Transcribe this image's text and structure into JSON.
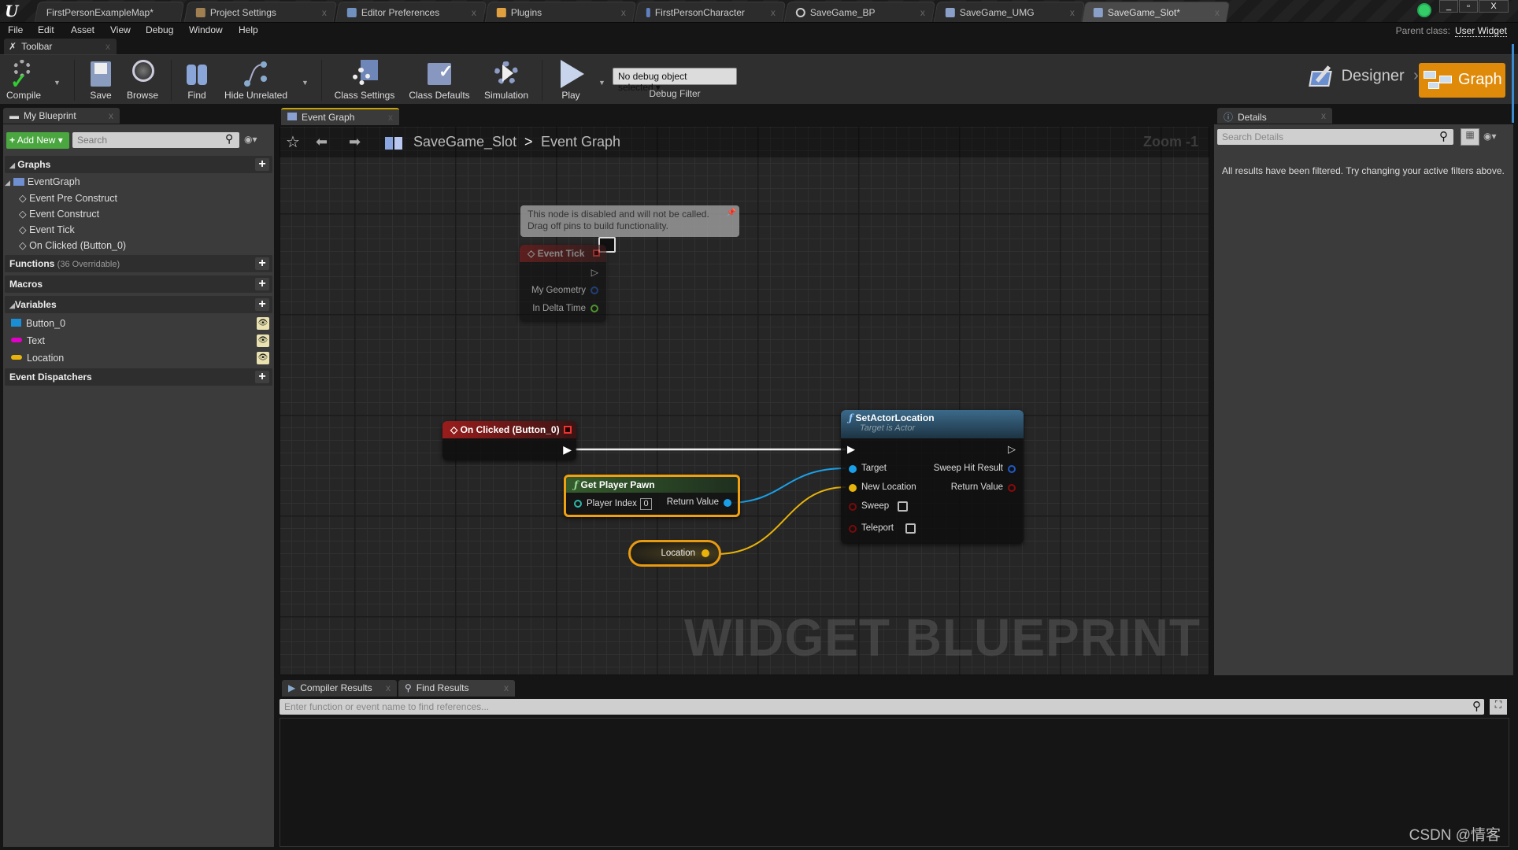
{
  "window": {
    "tabs": [
      {
        "label": "FirstPersonExampleMap*",
        "active": false
      },
      {
        "label": "Project Settings",
        "active": false
      },
      {
        "label": "Editor Preferences",
        "active": false
      },
      {
        "label": "Plugins",
        "active": false
      },
      {
        "label": "FirstPersonCharacter",
        "active": false
      },
      {
        "label": "SaveGame_BP",
        "active": false
      },
      {
        "label": "SaveGame_UMG",
        "active": false
      },
      {
        "label": "SaveGame_Slot*",
        "active": true
      }
    ],
    "close_glyph": "x",
    "controls": {
      "minimize": "_",
      "restore": "▫",
      "close": "X"
    }
  },
  "menubar": {
    "items": [
      "File",
      "Edit",
      "Asset",
      "View",
      "Debug",
      "Window",
      "Help"
    ],
    "parent_class_label": "Parent class:",
    "parent_class_value": "User Widget"
  },
  "toolbar": {
    "tab_label": "Toolbar",
    "buttons": [
      {
        "label": "Compile",
        "icon": "compile-icon"
      },
      {
        "label": "Save",
        "icon": "save-icon"
      },
      {
        "label": "Browse",
        "icon": "browse-icon"
      },
      {
        "label": "Find",
        "icon": "find-icon"
      },
      {
        "label": "Hide Unrelated",
        "icon": "hide-unrelated-icon"
      },
      {
        "label": "Class Settings",
        "icon": "class-settings-icon"
      },
      {
        "label": "Class Defaults",
        "icon": "class-defaults-icon"
      },
      {
        "label": "Simulation",
        "icon": "simulation-icon"
      },
      {
        "label": "Play",
        "icon": "play-icon"
      }
    ],
    "debug_select": "No debug object selected",
    "debug_label": "Debug Filter",
    "mode_designer": "Designer",
    "mode_graph": "Graph",
    "accent_color": "#e08a0a"
  },
  "my_blueprint": {
    "tab_label": "My Blueprint",
    "add_new": "Add New",
    "search_placeholder": "Search",
    "graphs_label": "Graphs",
    "event_graph": "EventGraph",
    "events": [
      "Event Pre Construct",
      "Event Construct",
      "Event Tick",
      "On Clicked (Button_0)"
    ],
    "functions_label": "Functions",
    "functions_count": "(36 Overridable)",
    "macros_label": "Macros",
    "variables_label": "Variables",
    "variables": [
      {
        "name": "Button_0",
        "color": "#1b8fd6"
      },
      {
        "name": "Text",
        "color": "#e000c8"
      },
      {
        "name": "Location",
        "color": "#e8b30a"
      }
    ],
    "dispatchers_label": "Event Dispatchers"
  },
  "graph": {
    "tab_label": "Event Graph",
    "breadcrumb_root": "SaveGame_Slot",
    "breadcrumb_sep": ">",
    "breadcrumb_current": "Event Graph",
    "zoom_label": "Zoom -1",
    "watermark": "WIDGET BLUEPRINT",
    "comment": {
      "line1": "This node is disabled and will not be called.",
      "line2": "Drag off pins to build functionality."
    },
    "event_tick": {
      "title": "Event Tick",
      "pins": [
        "My Geometry",
        "In Delta Time"
      ]
    },
    "on_clicked": {
      "title": "On Clicked (Button_0)"
    },
    "get_player_pawn": {
      "title": "Get Player Pawn",
      "input": "Player Index",
      "input_value": "0",
      "output": "Return Value"
    },
    "location_var": {
      "label": "Location"
    },
    "set_actor_location": {
      "title": "SetActorLocation",
      "subtitle": "Target is Actor",
      "inputs": [
        "Target",
        "New Location",
        "Sweep",
        "Teleport"
      ],
      "outputs": [
        "Sweep Hit Result",
        "Return Value"
      ]
    }
  },
  "details": {
    "tab_label": "Details",
    "search_placeholder": "Search Details",
    "message": "All results have been filtered. Try changing your active filters above."
  },
  "results": {
    "tabs": [
      "Compiler Results",
      "Find Results"
    ],
    "find_placeholder": "Enter function or event name to find references..."
  },
  "watermark_csdn": "CSDN @情客"
}
